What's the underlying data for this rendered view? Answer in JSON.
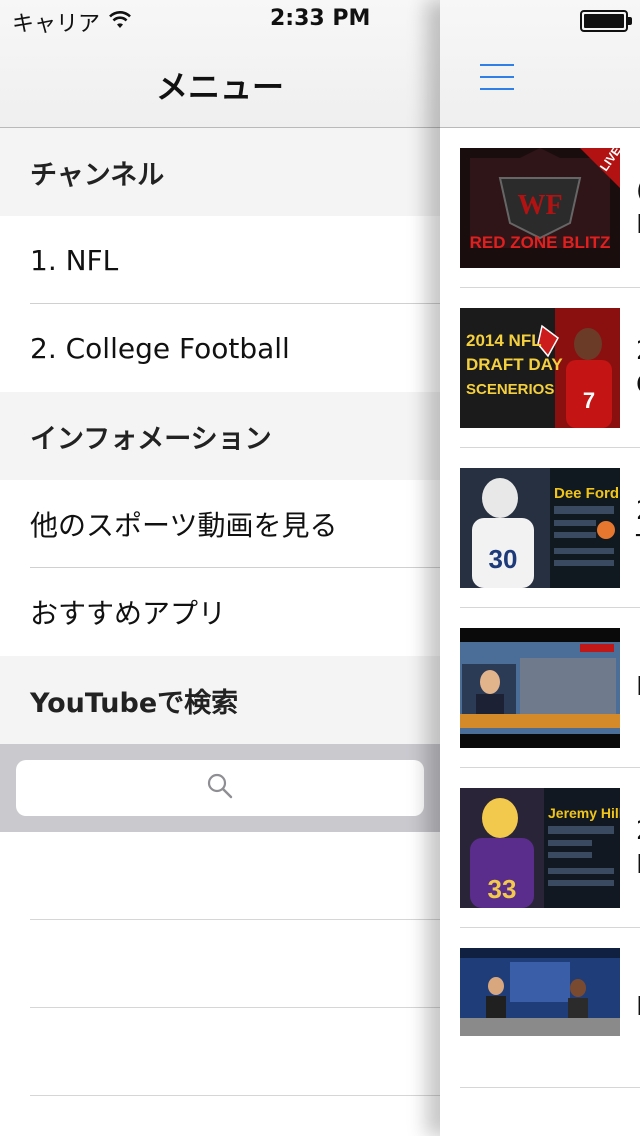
{
  "status_bar": {
    "carrier": "キャリア",
    "time": "2:33 PM"
  },
  "menu": {
    "title": "メニュー",
    "sections": [
      {
        "header": "チャンネル",
        "items": [
          "1. NFL",
          "2. College Football"
        ]
      },
      {
        "header": "インフォメーション",
        "items": [
          "他のスポーツ動画を見る",
          "おすすめアプリ"
        ]
      },
      {
        "header": "YouTubeで検索",
        "items": []
      }
    ],
    "search_icon": "search-icon"
  },
  "content": {
    "menu_icon": "hamburger-menu-icon",
    "accent_color": "#2f7fe6",
    "videos": [
      {
        "thumb_text_1": "WF",
        "thumb_text_2": "RED ZONE BLITZ",
        "thumb_badge": "LIVE",
        "title_peek": "(",
        "subtitle_peek": "I"
      },
      {
        "thumb_text_1": "2014 NFL",
        "thumb_text_2": "DRAFT DAY",
        "thumb_text_3": "SCENERIOS",
        "title_peek": "2",
        "subtitle_peek": "C"
      },
      {
        "thumb_text_1": "Dee Ford",
        "title_peek": "2",
        "subtitle_peek": "T"
      },
      {
        "title_peek": "I"
      },
      {
        "thumb_text_1": "Jeremy Hill",
        "title_peek": "2",
        "subtitle_peek": "I"
      },
      {
        "title_peek": "I"
      }
    ]
  }
}
